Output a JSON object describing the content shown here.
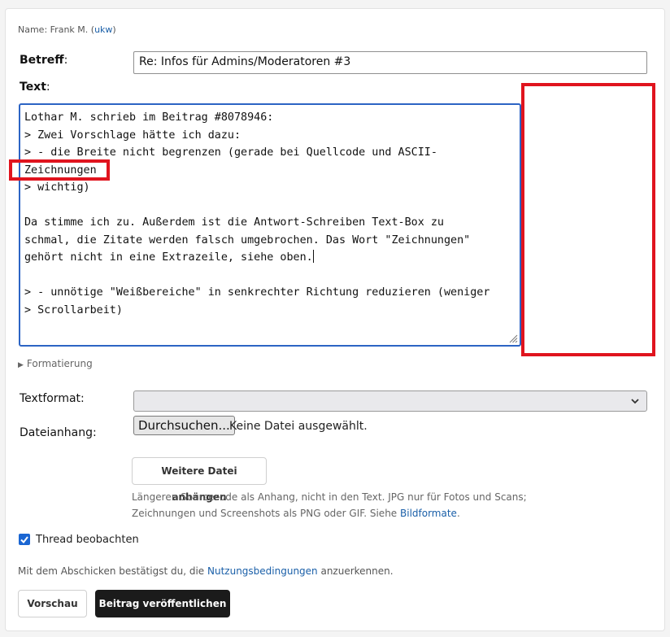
{
  "header": {
    "name_prefix": "Name: Frank M. (",
    "name_link": "ukw",
    "name_suffix": ")"
  },
  "subject": {
    "label": "Betreff",
    "colon": ":",
    "value": "Re: Infos für Admins/Moderatoren #3"
  },
  "text": {
    "label": "Text",
    "colon": ":",
    "lines": [
      "Lothar M. schrieb im Beitrag #8078946:",
      "> Zwei Vorschlage hätte ich dazu:",
      "> - die Breite nicht begrenzen (gerade bei Quellcode und ASCII-",
      "Zeichnungen",
      "> wichtig)",
      "",
      "Da stimme ich zu. Außerdem ist die Antwort-Schreiben Text-Box zu",
      "schmal, die Zitate werden falsch umgebrochen. Das Wort \"Zeichnungen\"",
      "gehört nicht in eine Extrazeile, siehe oben.",
      "",
      "> - unnötige \"Weißbereiche\" in senkrechter Richtung reduzieren (weniger",
      "> Scrollarbeit)"
    ]
  },
  "formatting_toggle": "Formatierung",
  "textformat": {
    "label": "Textformat:",
    "selected": ""
  },
  "attachment": {
    "label": "Dateianhang:",
    "browse_button": "Durchsuchen...",
    "no_file": "Keine Datei ausgewählt.",
    "more_button": "Weitere Datei anhängen",
    "hint_line1": "Längeren Sourcecode als Anhang, nicht in den Text. JPG nur für Fotos und Scans;",
    "hint_line2_prefix": "Zeichnungen und Screenshots als PNG oder GIF. Siehe ",
    "hint_link": "Bildformate",
    "hint_line2_suffix": "."
  },
  "watch_thread": {
    "label": "Thread beobachten",
    "checked": true
  },
  "terms": {
    "prefix": "Mit dem Abschicken bestätigst du, die ",
    "link": "Nutzungsbedingungen",
    "suffix": " anzuerkennen."
  },
  "actions": {
    "preview": "Vorschau",
    "publish": "Beitrag veröffentlichen"
  },
  "colors": {
    "accent": "#2c64c4",
    "highlight": "#e0141e",
    "primary_button": "#1b1b1b",
    "link": "#1a5fa8"
  }
}
